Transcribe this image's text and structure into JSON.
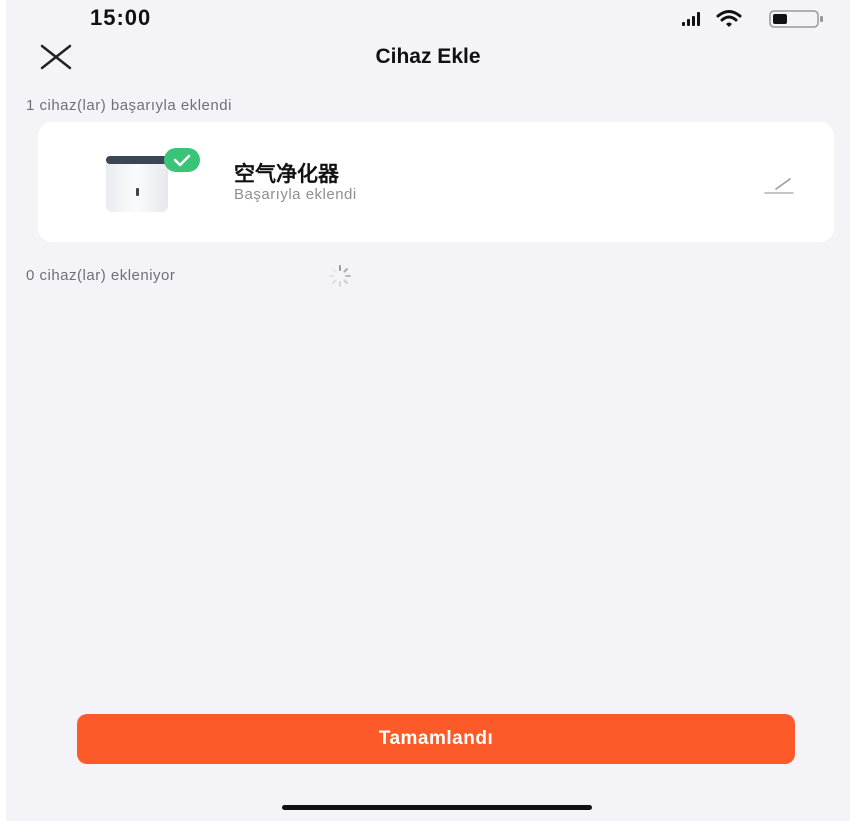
{
  "status_bar": {
    "time": "15:00",
    "icons": [
      "signal-icon",
      "wifi-icon",
      "battery-icon"
    ]
  },
  "header": {
    "title": "Cihaz Ekle",
    "close_icon": "close-icon"
  },
  "added_section": {
    "label": "1 cihaz(lar) başarıyla eklendi",
    "devices": [
      {
        "name": "空气净化器",
        "status": "Başarıyla eklendi",
        "image_icon": "air-purifier-icon",
        "badge_icon": "check-icon",
        "edit_icon": "edit-icon"
      }
    ]
  },
  "adding_section": {
    "label": "0 cihaz(lar) ekleniyor",
    "spinner_icon": "loading-spinner-icon"
  },
  "footer": {
    "done_label": "Tamamlandı"
  },
  "colors": {
    "accent": "#fc5a28",
    "success": "#39c477",
    "background": "#f4f4f8",
    "card": "#ffffff"
  }
}
